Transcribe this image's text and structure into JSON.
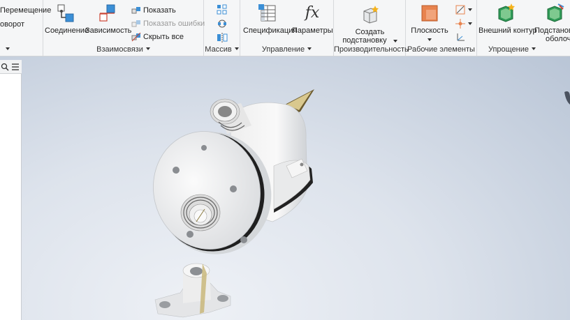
{
  "ribbon": {
    "partial_panel": {
      "items": [
        {
          "label": "Перемещение"
        },
        {
          "label": "оворот"
        }
      ]
    },
    "relations": {
      "title": "Взаимосвязи",
      "connection": "Соединение",
      "dependency": "Зависимость",
      "show": "Показать",
      "show_errors": "Показать ошибки",
      "hide_all": "Скрыть все"
    },
    "pattern": {
      "title": "Массив"
    },
    "manage": {
      "title": "Управление",
      "specification": "Спецификация",
      "parameters": "Параметры"
    },
    "productivity": {
      "title": "Производительность",
      "create_line1": "Создать",
      "create_line2": "подстановку"
    },
    "work_features": {
      "title": "Рабочие элементы",
      "plane": "Плоскость"
    },
    "simplification": {
      "title": "Упрощение",
      "shrinkwrap": "Внешний контур",
      "substitute_line1": "Подстанов",
      "substitute_line2": "оболочки"
    }
  },
  "colors": {
    "accent_blue": "#3b8fd6",
    "accent_orange": "#e8834e",
    "model_body": "#f4f4f4",
    "model_shadow": "#cfd2d6",
    "viewport_bg": "#dde3ec"
  },
  "icons": [
    "search-icon",
    "menu-icon",
    "connection-icon",
    "dependency-icon",
    "show-icon",
    "show-errors-icon",
    "hide-all-icon",
    "pattern-rect-icon",
    "pattern-circ-icon",
    "pattern-mirror-icon",
    "specification-icon",
    "fx-icon",
    "create-substitute-icon",
    "plane-icon",
    "axis-icon",
    "point-icon",
    "ucs-icon",
    "shrinkwrap-icon",
    "substitute-icon"
  ]
}
